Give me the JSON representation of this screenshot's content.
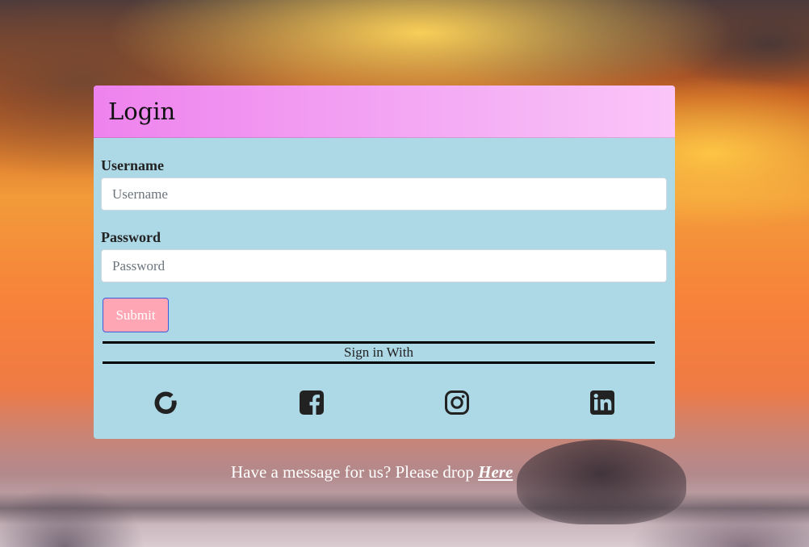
{
  "card": {
    "title": "Login",
    "username": {
      "label": "Username",
      "placeholder": "Username",
      "value": ""
    },
    "password": {
      "label": "Password",
      "placeholder": "Password",
      "value": ""
    },
    "submit_label": "Submit",
    "signin_with": "Sign in With",
    "social": [
      {
        "name": "google",
        "icon": "google-icon"
      },
      {
        "name": "facebook",
        "icon": "facebook-icon"
      },
      {
        "name": "instagram",
        "icon": "instagram-icon"
      },
      {
        "name": "linkedin",
        "icon": "linkedin-icon"
      }
    ]
  },
  "footer": {
    "message": "Have a message for us? Please drop ",
    "link_label": " Here"
  },
  "colors": {
    "card_bg": "#add8e6",
    "header_start": "#ee82ee",
    "header_end": "#fbc5f8",
    "submit_bg": "#ffa6b4",
    "icon": "#222222"
  }
}
